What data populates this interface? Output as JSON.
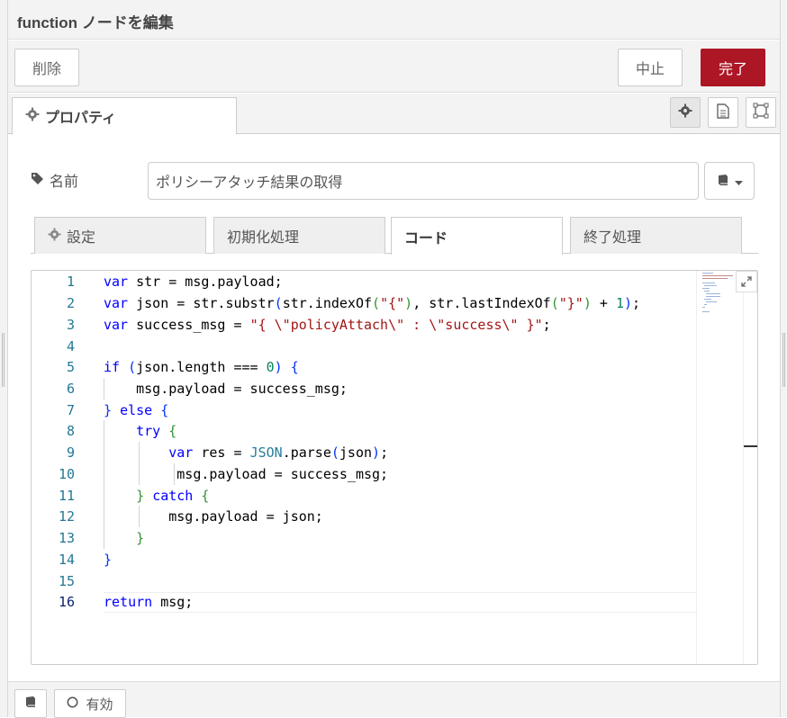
{
  "title": "function ノードを編集",
  "buttons": {
    "delete": "削除",
    "cancel": "中止",
    "done": "完了"
  },
  "colors": {
    "primary": "#ad1625",
    "tab_bg": "#efefef",
    "border": "#cccccc"
  },
  "main_tab": {
    "icon": "gear-icon",
    "label": "プロパティ"
  },
  "tab_icons": [
    "gear-icon",
    "document-icon",
    "frame-icon"
  ],
  "name_field": {
    "icon": "tag-icon",
    "label": "名前",
    "value": "ポリシーアタッチ結果の取得"
  },
  "sub_tabs": [
    {
      "icon": "gear-icon",
      "label": "設定"
    },
    {
      "label": "初期化処理"
    },
    {
      "label": "コード",
      "active": true
    },
    {
      "label": "終了処理"
    }
  ],
  "editor": {
    "current_line": 16,
    "lines": [
      "var str = msg.payload;",
      "var json = str.substr(str.indexOf(\"{\"), str.lastIndexOf(\"}\") + 1);",
      "var success_msg = \"{ \\\"policyAttach\\\" : \\\"success\\\" }\";",
      "",
      "if (json.length === 0) {",
      "    msg.payload = success_msg;",
      "} else {",
      "    try {",
      "        var res = JSON.parse(json);",
      "         msg.payload = success_msg;",
      "    } catch {",
      "        msg.payload = json;",
      "    }",
      "}",
      "",
      "return msg;"
    ]
  },
  "footer": {
    "enabled_label": "有効"
  }
}
